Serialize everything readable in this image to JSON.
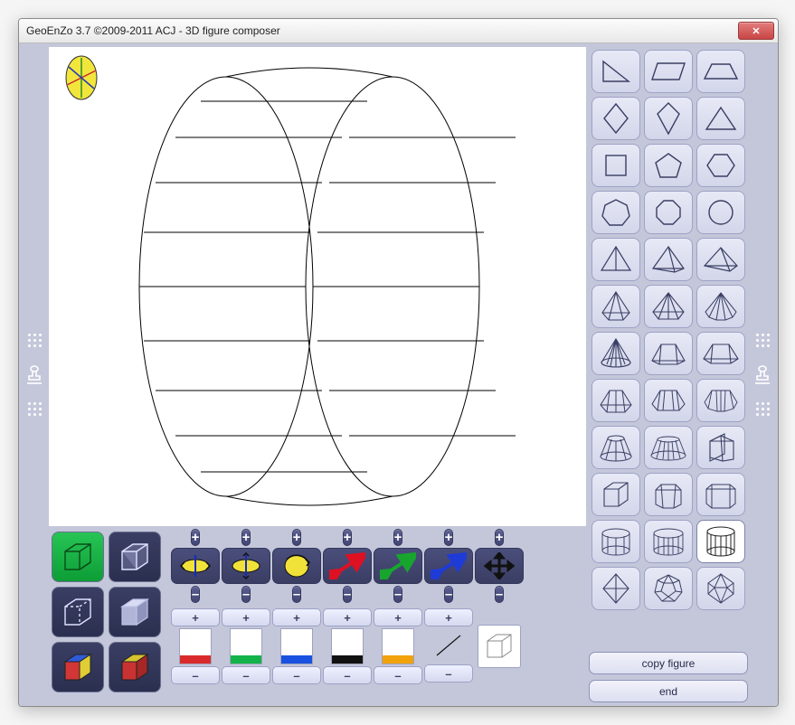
{
  "window": {
    "title": "GeoEnZo 3.7 ©2009-2011 ACJ - 3D figure composer"
  },
  "rotation_controls": {
    "plus": "+",
    "minus": "–"
  },
  "swatches": [
    {
      "top": "#ffffff",
      "bar": "#d92b2b"
    },
    {
      "top": "#ffffff",
      "bar": "#13b34a"
    },
    {
      "top": "#ffffff",
      "bar": "#1952e0"
    },
    {
      "top": "#ffffff",
      "bar": "#111111"
    },
    {
      "top": "#ffffff",
      "bar": "#f2a20b"
    }
  ],
  "shape_palette": [
    "right-triangle",
    "parallelogram",
    "trapezoid",
    "rhombus",
    "kite",
    "triangle",
    "square",
    "pentagon",
    "hexagon",
    "heptagon",
    "octagon",
    "circle",
    "tetrahedron",
    "square-pyramid",
    "rect-pyramid",
    "pentagonal-pyramid",
    "hexagonal-pyramid",
    "octagonal-pyramid",
    "cone",
    "frustum-square",
    "frustum-rect",
    "frustum-pent",
    "frustum-hex",
    "frustum-oct",
    "frustum-cone-1",
    "frustum-cone-2",
    "triangular-prism",
    "cube",
    "pentagonal-prism",
    "hexagonal-prism",
    "heptagonal-prism",
    "octagonal-prism",
    "cylinder",
    "octahedron",
    "dodecahedron",
    "icosahedron"
  ],
  "selected_shape_index": 32,
  "actions": {
    "copy": "copy figure",
    "end": "end"
  }
}
